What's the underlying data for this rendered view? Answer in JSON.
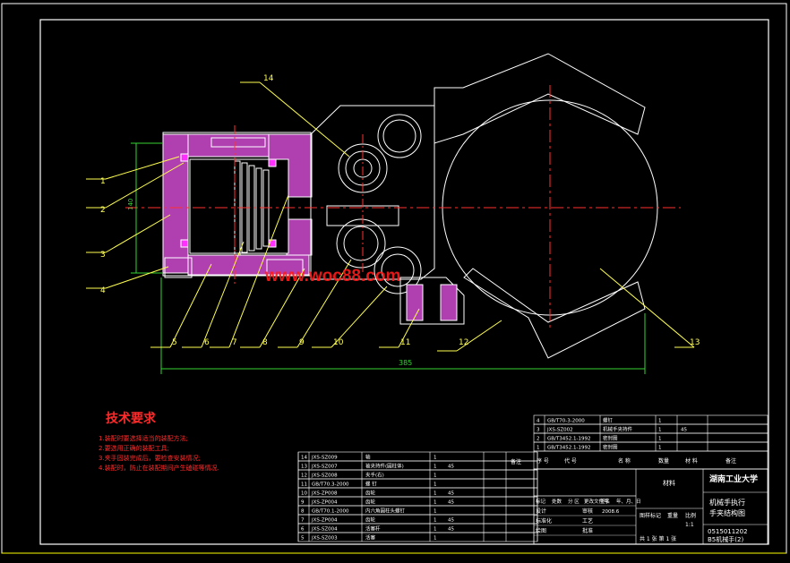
{
  "colors": {
    "background": "#000000",
    "outline": "#ffffff",
    "frame_line": "#ffff00",
    "part": "#ffffff",
    "hatch": "#d64ad6",
    "centerline": "#ff3030",
    "dimension": "#35d335",
    "leader": "#ffff50",
    "tech_title": "#ff2a2a",
    "watermark": "#ff1a1a"
  },
  "balloons": [
    "1",
    "2",
    "3",
    "4",
    "5",
    "6",
    "7",
    "8",
    "9",
    "10",
    "11",
    "12",
    "13",
    "14"
  ],
  "dimensions": {
    "overall_length": "385",
    "height": "140"
  },
  "watermark": "www.woc88.com",
  "tech_requirements": {
    "title": "技术要求",
    "items": [
      "1.装配时要选择适当的装配方法;",
      "2.要选用正确的装配工具;",
      "3.夹手固装完成后，要检查安装情况;",
      "4.装配时，防止在装配期间产生磕碰等情况."
    ]
  },
  "parts_list": {
    "rows": [
      {
        "no": "14",
        "code": "JXS-SZ009",
        "name": "轴",
        "qty": "1",
        "material": ""
      },
      {
        "no": "13",
        "code": "JXS-SZ007",
        "name": "被夹持件(圆柱体)",
        "qty": "1",
        "material": "45"
      },
      {
        "no": "12",
        "code": "JXS-SZ008",
        "name": "夹手(右)",
        "qty": "1",
        "material": ""
      },
      {
        "no": "11",
        "code": "GB/T70.3-2000",
        "name": "螺 钉",
        "qty": "1",
        "material": ""
      },
      {
        "no": "10",
        "code": "JXS-ZP008",
        "name": "齿轮",
        "qty": "1",
        "material": "45"
      },
      {
        "no": "9",
        "code": "JXS-ZP004",
        "name": "齿轮",
        "qty": "1",
        "material": "45"
      },
      {
        "no": "8",
        "code": "GB/T70.1-2000",
        "name": "内六角圆柱头螺钉",
        "qty": "1",
        "material": ""
      },
      {
        "no": "7",
        "code": "JXS-ZP004",
        "name": "齿轮",
        "qty": "1",
        "material": "45"
      },
      {
        "no": "6",
        "code": "JXS-SZ004",
        "name": "活塞杆",
        "qty": "1",
        "material": "45"
      },
      {
        "no": "5",
        "code": "JXS-SZ003",
        "name": "活塞",
        "qty": "1",
        "material": ""
      }
    ],
    "header_remark": "备注"
  },
  "upper_list": {
    "rows": [
      {
        "no": "4",
        "code": "GB/T70-3-2000",
        "name": "螺钉",
        "qty": "1",
        "material": ""
      },
      {
        "no": "3",
        "code": "JXS-SZ002",
        "name": "机械手夹持件",
        "qty": "1",
        "material": "45"
      },
      {
        "no": "2",
        "code": "GB/T3452.1-1992",
        "name": "密封圈",
        "qty": "1",
        "material": ""
      },
      {
        "no": "1",
        "code": "GB/T3452.1-1992",
        "name": "密封圈",
        "qty": "1",
        "material": ""
      }
    ],
    "header_no": "序 号",
    "header_code": "代 号",
    "header_name": "名 称",
    "header_qty": "数量",
    "header_material": "材 料",
    "header_remark": "备注"
  },
  "title_block": {
    "university": "湖南工业大学",
    "drawing_name_1": "机械手执行",
    "drawing_name_2": "手夹结构图",
    "drawing_number": "0515011202",
    "sheet_title": "B5机械手(2)",
    "material_label": "材料",
    "scale_label": "比例",
    "scale": "1:1",
    "stage_label": "图样标记",
    "weight_label": "重量",
    "sheet_info": "共 1 张  第 1 张",
    "row_labels": [
      "标记",
      "处数",
      "分 区",
      "更改文件号",
      "签名",
      "年、月、日"
    ],
    "sign_labels": [
      "设计",
      "标准化",
      "绘图",
      "审核",
      "工艺",
      "批准"
    ],
    "date_sample": "2008.6"
  }
}
